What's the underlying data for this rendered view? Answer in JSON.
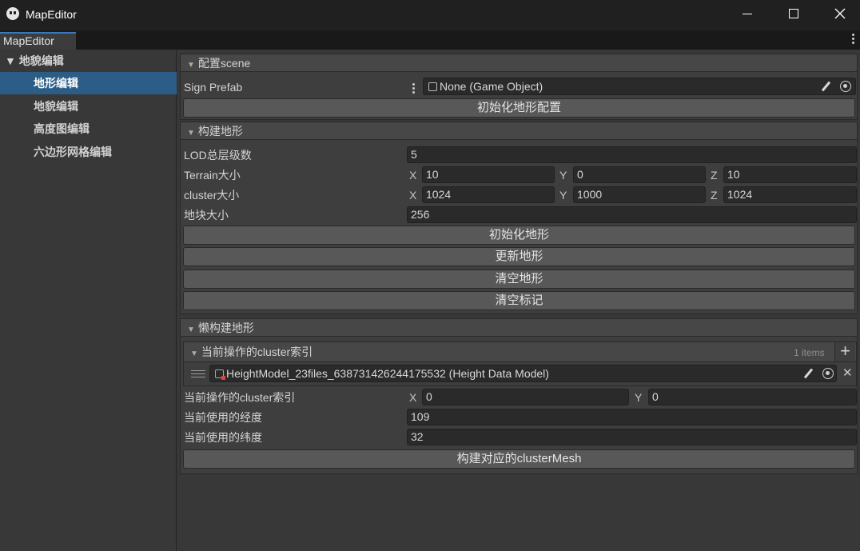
{
  "window": {
    "title": "MapEditor"
  },
  "tab": {
    "label": "MapEditor"
  },
  "sidebar": {
    "root": "▼ 地貌编辑",
    "items": [
      {
        "label": "地形编辑",
        "selected": true
      },
      {
        "label": "地貌编辑",
        "selected": false
      },
      {
        "label": "高度图编辑",
        "selected": false
      },
      {
        "label": "六边形网格编辑",
        "selected": false
      }
    ]
  },
  "config_scene": {
    "title": "配置scene",
    "sign_prefab_label": "Sign Prefab",
    "sign_prefab_value": "None (Game Object)",
    "init_button": "初始化地形配置"
  },
  "build_terrain": {
    "title": "构建地形",
    "lod_label": "LOD总层级数",
    "lod_value": "5",
    "terrain_size_label": "Terrain大小",
    "terrain_size": {
      "x": "10",
      "y": "0",
      "z": "10"
    },
    "cluster_size_label": "cluster大小",
    "cluster_size": {
      "x": "1024",
      "y": "1000",
      "z": "1024"
    },
    "tile_size_label": "地块大小",
    "tile_size_value": "256",
    "buttons": [
      "初始化地形",
      "更新地形",
      "清空地形",
      "清空标记"
    ]
  },
  "lazy_build": {
    "title": "懒构建地形",
    "list_title": "当前操作的cluster索引",
    "list_count": "1 items",
    "list_item": "HeightModel_23files_638731426244175532 (Height Data Model)",
    "cluster_index_label": "当前操作的cluster索引",
    "cluster_index": {
      "x": "0",
      "y": "0"
    },
    "longitude_label": "当前使用的经度",
    "longitude_value": "109",
    "latitude_label": "当前使用的纬度",
    "latitude_value": "32",
    "build_button": "构建对应的clusterMesh"
  },
  "axis_labels": {
    "x": "X",
    "y": "Y",
    "z": "Z"
  },
  "icons": [
    "app-icon",
    "minimize-icon",
    "maximize-icon",
    "close-icon",
    "kebab-menu-icon",
    "gameobject-icon",
    "pencil-icon",
    "object-picker-icon",
    "drag-handle-icon",
    "plus-icon",
    "remove-icon",
    "model-asset-icon"
  ]
}
